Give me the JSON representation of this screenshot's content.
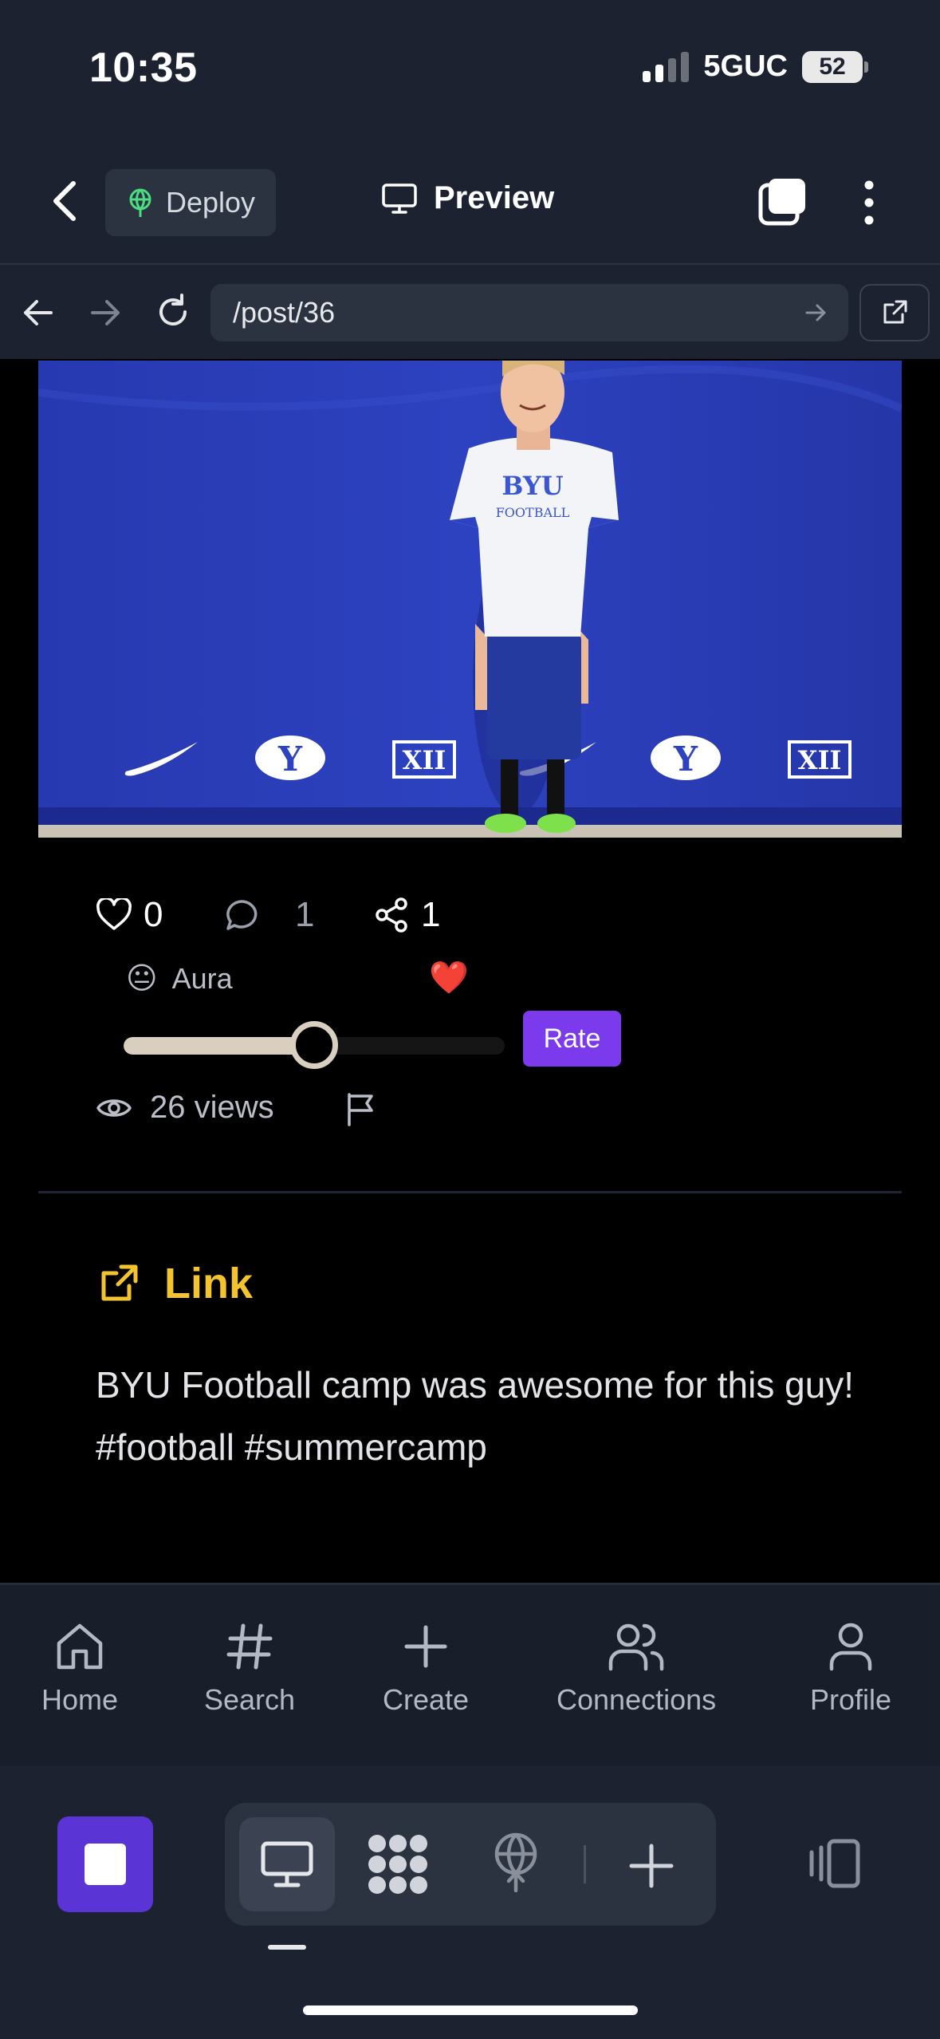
{
  "status_bar": {
    "time": "10:35",
    "network": "5GUC",
    "battery": "52"
  },
  "header": {
    "deploy_label": "Deploy",
    "preview_label": "Preview"
  },
  "browser": {
    "url": "/post/36"
  },
  "post": {
    "likes": "0",
    "comments": "1",
    "shares": "1",
    "aura_emoji": "😐",
    "aura_label": "Aura",
    "heart_emoji": "❤️",
    "rating_fraction": 0.5,
    "rate_label": "Rate",
    "views": "26 views",
    "link_label": "Link",
    "description": "BYU Football camp was awesome for this guy! #football #summercamp",
    "image_text": {
      "shirt_top": "BYU",
      "shirt_bottom": "FOOTBALL",
      "logo": "Y",
      "conference": "XII"
    }
  },
  "bottom_nav": {
    "items": [
      {
        "label": "Home",
        "icon": "home-icon"
      },
      {
        "label": "Search",
        "icon": "hash-icon"
      },
      {
        "label": "Create",
        "icon": "plus-icon"
      },
      {
        "label": "Connections",
        "icon": "users-icon"
      },
      {
        "label": "Profile",
        "icon": "user-icon"
      }
    ]
  },
  "colors": {
    "accent": "#7c3aed",
    "link": "#f4c430",
    "stop_button": "#5b34d6",
    "header_bg": "#1c2230"
  }
}
